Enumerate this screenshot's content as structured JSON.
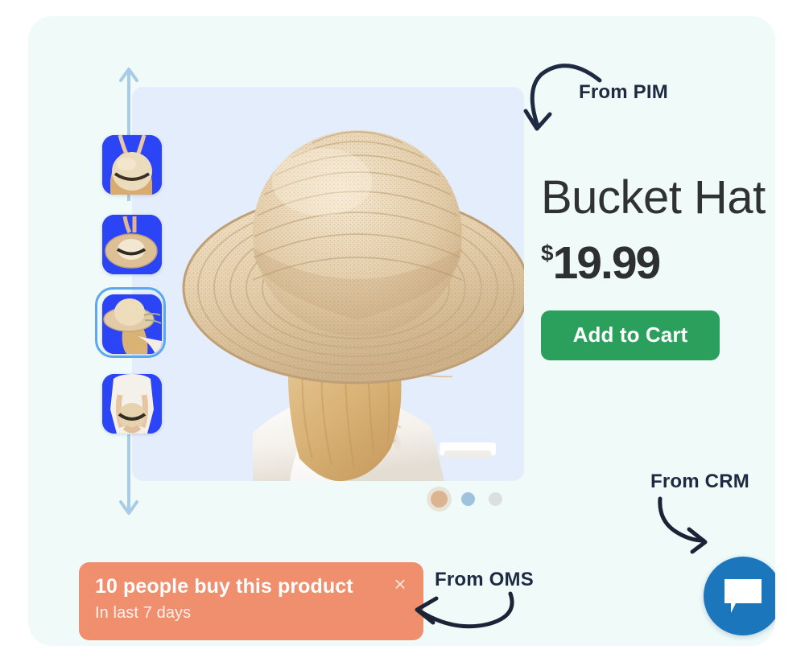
{
  "card": {
    "background_color": "#effaf9",
    "image_panel_color": "#e4edfc"
  },
  "gallery": {
    "resize_up_icon": "arrow-up-icon",
    "resize_down_icon": "arrow-down-icon",
    "arrow_color": "#a9cbe6",
    "thumbnails": [
      {
        "alt": "woman holding straw hat in front of body",
        "selected": false
      },
      {
        "alt": "flat top view of straw sun hat",
        "selected": false
      },
      {
        "alt": "woman from behind wearing wide brim straw hat",
        "selected": true
      },
      {
        "alt": "woman holding hat behind her back",
        "selected": false
      }
    ],
    "thumbnail_background_color": "#2b44f5",
    "selected_ring_color": "#5aa8f0",
    "hero_alt": "Back view of blonde woman wearing a wide-brim woven straw bucket hat",
    "dots": [
      {
        "name": "carousel-dot-1",
        "color": "#dbb491",
        "active": true
      },
      {
        "name": "carousel-dot-2",
        "color": "#9fc2de",
        "active": false
      },
      {
        "name": "carousel-dot-3",
        "color": "#dcdfe0",
        "active": false
      }
    ]
  },
  "product": {
    "title": "Bucket Hat",
    "price_currency": "$",
    "price_amount": "19.99",
    "add_to_cart_label": "Add to Cart",
    "add_to_cart_color": "#2ba05c"
  },
  "annotations": {
    "pim": {
      "label": "From PIM",
      "arrow_icon": "curved-arrow-down-left-icon"
    },
    "crm": {
      "label": "From CRM",
      "arrow_icon": "curved-arrow-down-right-icon"
    },
    "oms": {
      "label": "From OMS",
      "arrow_icon": "curved-arrow-left-icon"
    },
    "text_color": "#1e2a42"
  },
  "social_proof": {
    "headline": "10 people buy this product",
    "subtext": "In last 7 days",
    "close_icon": "close-icon",
    "close_label": "×",
    "background_color": "#ef8f6e"
  },
  "chat": {
    "icon": "chat-bubble-icon",
    "background_color": "#1b76bc"
  }
}
